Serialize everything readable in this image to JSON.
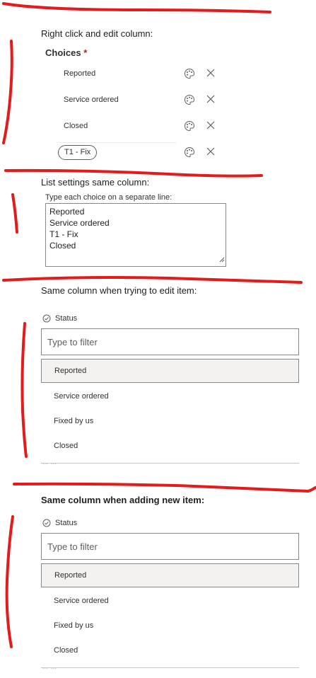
{
  "section1": {
    "heading": "Right click and edit column:",
    "choices_label": "Choices",
    "required_mark": "*",
    "choices": [
      "Reported",
      "Service ordered",
      "Closed"
    ],
    "pill_choice": "T1 - Fix",
    "icons": {
      "color": "palette-icon",
      "remove": "close-icon"
    }
  },
  "section2": {
    "heading": "List settings same column:",
    "label": "Type each choice on a separate line:",
    "lines": [
      "Reported",
      "Service ordered",
      "T1 - Fix",
      "Closed"
    ]
  },
  "section3": {
    "heading": "Same column when trying to edit item:",
    "status_label": "Status",
    "filter_placeholder": "Type to filter",
    "options": [
      "Reported",
      "Service ordered",
      "Fixed by us",
      "Closed"
    ],
    "selected": "Reported",
    "cut_text": "… …"
  },
  "section4": {
    "heading": "Same column when adding new item:",
    "status_label": "Status",
    "filter_placeholder": "Type to filter",
    "options": [
      "Reported",
      "Service ordered",
      "Fixed by us",
      "Closed"
    ],
    "selected": "Reported",
    "cut_text": "… …"
  },
  "colors": {
    "annotation_red": "#e31b1b",
    "selected_bg": "#f3f2f1",
    "border": "#8a8886",
    "required": "#a4262c"
  }
}
